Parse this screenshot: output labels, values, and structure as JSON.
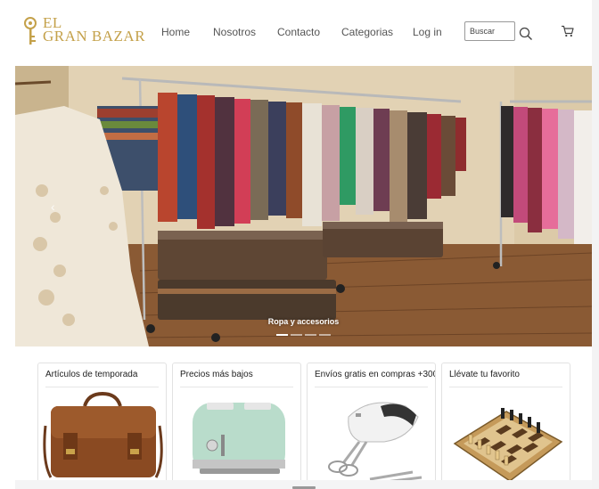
{
  "brand": {
    "line1": "EL",
    "line2": "GRAN BAZAR",
    "color": "#c4a14a"
  },
  "nav": {
    "items": [
      {
        "label": "Home"
      },
      {
        "label": "Nosotros"
      },
      {
        "label": "Contacto"
      },
      {
        "label": "Categorias"
      },
      {
        "label": "Log in"
      }
    ]
  },
  "search": {
    "placeholder": "Buscar",
    "icon": "search-icon"
  },
  "cart": {
    "icon": "cart-icon"
  },
  "carousel": {
    "caption": "Ropa y accesorios",
    "slide_count": 4,
    "active_index": 0
  },
  "cards": [
    {
      "title": "Artículos de temporada",
      "image": "leather-bag"
    },
    {
      "title": "Precios más bajos",
      "image": "toaster"
    },
    {
      "title": "Envíos gratis en compras +300",
      "image": "hand-mixer"
    },
    {
      "title": "Llévate tu favorito",
      "image": "chess-board"
    }
  ]
}
